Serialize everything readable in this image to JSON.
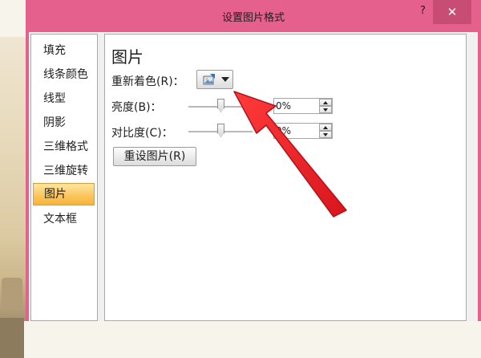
{
  "dialog": {
    "title": "设置图片格式",
    "help_label": "?",
    "close_label": "✕"
  },
  "sidebar": {
    "items": [
      {
        "label": "填充",
        "selected": false
      },
      {
        "label": "线条颜色",
        "selected": false
      },
      {
        "label": "线型",
        "selected": false
      },
      {
        "label": "阴影",
        "selected": false
      },
      {
        "label": "三维格式",
        "selected": false
      },
      {
        "label": "三维旋转",
        "selected": false
      },
      {
        "label": "图片",
        "selected": true
      },
      {
        "label": "文本框",
        "selected": false
      }
    ]
  },
  "panel": {
    "title": "图片",
    "recolor_label": "重新着色(R)：",
    "recolor_icon": "picture-recolor-icon",
    "brightness": {
      "label": "亮度(B)：",
      "value": "0%",
      "level": 0.5
    },
    "contrast": {
      "label": "对比度(C)：",
      "value": "0%",
      "level": 0.5
    },
    "reset_label": "重设图片(R)"
  },
  "annotation": {
    "icon": "red-arrow",
    "color": "#e8242a"
  },
  "colors": {
    "titlebar": "#e5608c",
    "close_button": "#c84d74",
    "selection": "#f7b43c"
  }
}
